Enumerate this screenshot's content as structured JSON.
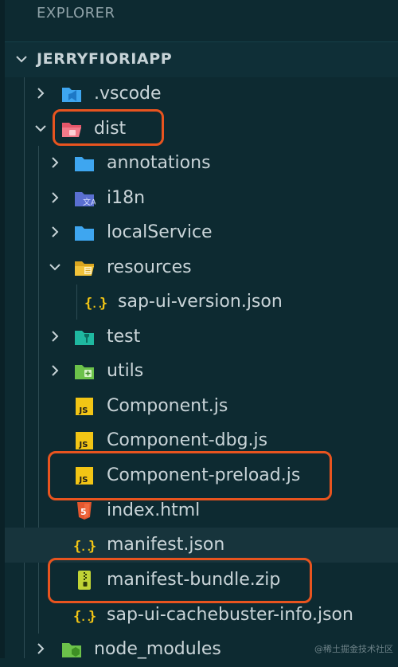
{
  "panel": {
    "header": "EXPLORER",
    "project": "JERRYFIORIAPP"
  },
  "tree": [
    {
      "label": ".vscode",
      "icon": "vscode-folder-icon",
      "chevron": "collapsed"
    },
    {
      "label": "dist",
      "icon": "dist-folder-open-icon",
      "chevron": "expanded",
      "highlighted": true
    },
    {
      "label": "annotations",
      "icon": "folder-icon",
      "chevron": "collapsed"
    },
    {
      "label": "i18n",
      "icon": "i18n-folder-icon",
      "chevron": "collapsed"
    },
    {
      "label": "localService",
      "icon": "folder-icon",
      "chevron": "collapsed"
    },
    {
      "label": "resources",
      "icon": "resources-folder-open-icon",
      "chevron": "expanded"
    },
    {
      "label": "sap-ui-version.json",
      "icon": "json-icon"
    },
    {
      "label": "test",
      "icon": "test-folder-icon",
      "chevron": "collapsed"
    },
    {
      "label": "utils",
      "icon": "utils-folder-icon",
      "chevron": "collapsed"
    },
    {
      "label": "Component.js",
      "icon": "js-icon"
    },
    {
      "label": "Component-dbg.js",
      "icon": "js-icon"
    },
    {
      "label": "Component-preload.js",
      "icon": "js-icon",
      "highlighted": true
    },
    {
      "label": "index.html",
      "icon": "html-icon"
    },
    {
      "label": "manifest.json",
      "icon": "json-icon"
    },
    {
      "label": "manifest-bundle.zip",
      "icon": "zip-icon",
      "highlighted": true
    },
    {
      "label": "sap-ui-cachebuster-info.json",
      "icon": "json-icon"
    },
    {
      "label": "node_modules",
      "icon": "node-folder-icon",
      "chevron": "collapsed"
    }
  ],
  "watermark": "@稀土掘金技术社区",
  "colors": {
    "background": "#0d2a31",
    "highlight": "#e8541f",
    "folder": "#3ea6f0",
    "js": "#f2c515",
    "json": "#f2c515"
  }
}
